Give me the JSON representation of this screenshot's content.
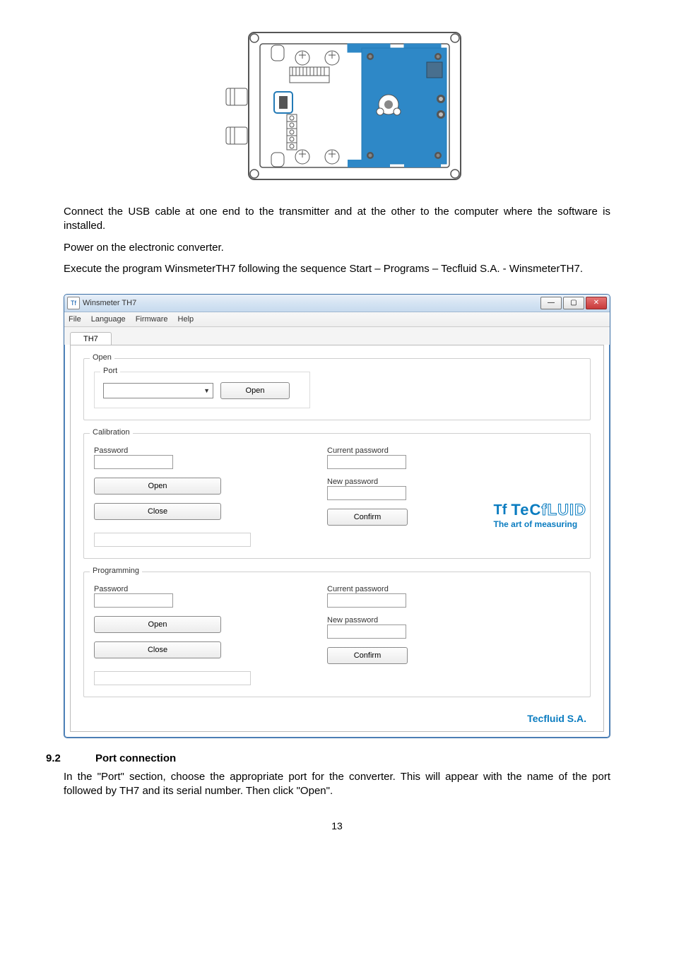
{
  "body": {
    "p1": "Connect the USB cable at one end to the transmitter and at the other to the computer where the software is installed.",
    "p2": "Power on the electronic converter.",
    "p3": "Execute the program WinsmeterTH7 following the sequence Start – Programs – Tecfluid S.A. - WinsmeterTH7."
  },
  "app": {
    "icon_text": "Tf",
    "title": "Winsmeter TH7",
    "menu": {
      "file": "File",
      "language": "Language",
      "firmware": "Firmware",
      "help": "Help"
    },
    "tab": "TH7",
    "groups": {
      "open": {
        "legend": "Open",
        "port_legend": "Port",
        "open_btn": "Open"
      },
      "calibration": {
        "legend": "Calibration",
        "password_label": "Password",
        "open_btn": "Open",
        "close_btn": "Close",
        "current_pw": "Current password",
        "new_pw": "New password",
        "confirm_btn": "Confirm"
      },
      "programming": {
        "legend": "Programming",
        "password_label": "Password",
        "open_btn": "Open",
        "close_btn": "Close",
        "current_pw": "Current password",
        "new_pw": "New password",
        "confirm_btn": "Confirm"
      }
    },
    "brand": {
      "tf": "Tf",
      "tec": "TeC",
      "fluid": "fLUID",
      "tag": "The art of measuring",
      "company": "Tecfluid S.A."
    }
  },
  "section": {
    "num": "9.2",
    "title": "Port connection",
    "p": "In the \"Port\" section, choose the appropriate port for the converter. This will appear with the name of the port followed by TH7 and its serial number. Then click \"Open\"."
  },
  "page_number": "13"
}
